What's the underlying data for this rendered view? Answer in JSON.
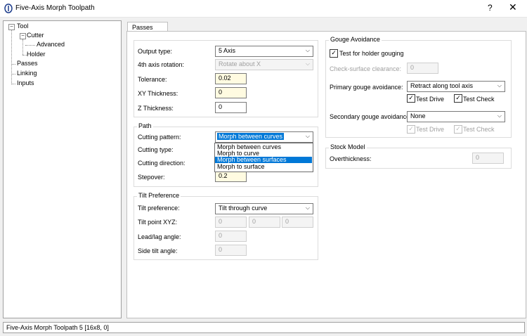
{
  "window": {
    "title": "Five-Axis Morph Toolpath",
    "help_label": "?",
    "close_label": "✕"
  },
  "tree": {
    "tool": "Tool",
    "cutter": "Cutter",
    "advanced": "Advanced",
    "holder": "Holder",
    "passes": "Passes",
    "linking": "Linking",
    "inputs": "Inputs",
    "expanded": "−"
  },
  "tab": {
    "label": "Passes"
  },
  "general": {
    "output_type_label": "Output type:",
    "output_type_value": "5 Axis",
    "axis4_label": "4th axis rotation:",
    "axis4_value": "Rotate  about X",
    "tolerance_label": "Tolerance:",
    "tolerance_value": "0.02",
    "xy_thickness_label": "XY Thickness:",
    "xy_thickness_value": "0",
    "z_thickness_label": "Z Thickness:",
    "z_thickness_value": "0"
  },
  "path": {
    "title": "Path",
    "cutting_pattern_label": "Cutting pattern:",
    "cutting_pattern_value": "Morph between curves",
    "cutting_type_label": "Cutting type:",
    "cutting_direction_label": "Cutting direction:",
    "stepover_label": "Stepover:",
    "stepover_value": "0.2",
    "options": [
      "Morph between curves",
      "Morph to curve",
      "Morph between surfaces",
      "Morph to surface"
    ],
    "highlighted": "Morph between surfaces"
  },
  "tilt": {
    "title": "Tilt Preference",
    "tilt_pref_label": "Tilt preference:",
    "tilt_pref_value": "Tilt through curve",
    "tilt_point_label": "Tilt point XYZ:",
    "tilt_x": "0",
    "tilt_y": "0",
    "tilt_z": "0",
    "lead_lag_label": "Lead/lag angle:",
    "lead_lag_value": "0",
    "side_tilt_label": "Side tilt angle:",
    "side_tilt_value": "0"
  },
  "gouge": {
    "title": "Gouge Avoidance",
    "holder_label": "Test for holder gouging",
    "clearance_label": "Check-surface clearance:",
    "clearance_value": "0",
    "primary_label": "Primary gouge avoidance:",
    "primary_value": "Retract along tool axis",
    "test_drive": "Test Drive",
    "test_check": "Test Check",
    "secondary_label": "Secondary gouge avoidance:",
    "secondary_value": "None",
    "test_drive2": "Test Drive",
    "test_check2": "Test Check",
    "check_mark": "✓"
  },
  "stock": {
    "title": "Stock Model",
    "overthickness_label": "Overthickness:",
    "overthickness_value": "0"
  },
  "status": {
    "text": "Five-Axis Morph Toolpath 5 [16x8, 0]"
  },
  "icons": {
    "chevron": "⌵"
  }
}
